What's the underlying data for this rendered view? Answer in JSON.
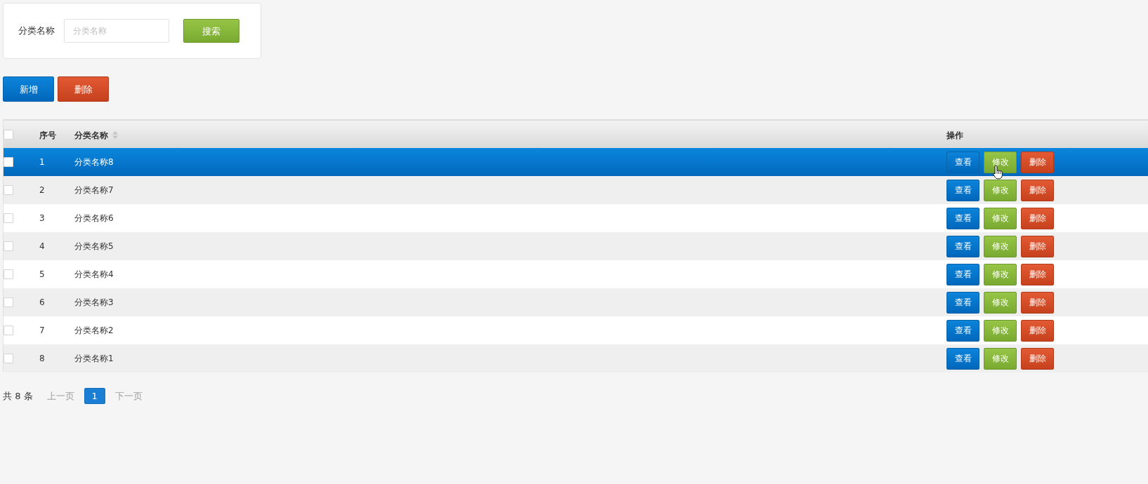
{
  "search": {
    "label": "分类名称",
    "placeholder": "分类名称",
    "button": "搜索"
  },
  "toolbar": [
    {
      "label": "新增",
      "kind": "add"
    },
    {
      "label": "删除",
      "kind": "delete"
    }
  ],
  "table": {
    "select_all": {
      "checked": false
    },
    "columns": [
      {
        "label": "序号",
        "sortable": false
      },
      {
        "label": "分类名称",
        "sortable": true
      },
      {
        "label": "操作",
        "sortable": false
      }
    ],
    "rows": [
      {
        "selected": true,
        "checked": false,
        "number": "1",
        "name": "分类名称8",
        "actions": [
          {
            "label": "查看",
            "kind": "view",
            "hovered": false
          },
          {
            "label": "修改",
            "kind": "edit",
            "hovered": true
          },
          {
            "label": "删除",
            "kind": "delete",
            "hovered": false
          }
        ]
      },
      {
        "selected": false,
        "checked": false,
        "number": "2",
        "name": "分类名称7",
        "actions": [
          {
            "label": "查看",
            "kind": "view",
            "hovered": false
          },
          {
            "label": "修改",
            "kind": "edit",
            "hovered": false
          },
          {
            "label": "删除",
            "kind": "delete",
            "hovered": false
          }
        ]
      },
      {
        "selected": false,
        "checked": false,
        "number": "3",
        "name": "分类名称6",
        "actions": [
          {
            "label": "查看",
            "kind": "view",
            "hovered": false
          },
          {
            "label": "修改",
            "kind": "edit",
            "hovered": false
          },
          {
            "label": "删除",
            "kind": "delete",
            "hovered": false
          }
        ]
      },
      {
        "selected": false,
        "checked": false,
        "number": "4",
        "name": "分类名称5",
        "actions": [
          {
            "label": "查看",
            "kind": "view",
            "hovered": false
          },
          {
            "label": "修改",
            "kind": "edit",
            "hovered": false
          },
          {
            "label": "删除",
            "kind": "delete",
            "hovered": false
          }
        ]
      },
      {
        "selected": false,
        "checked": false,
        "number": "5",
        "name": "分类名称4",
        "actions": [
          {
            "label": "查看",
            "kind": "view",
            "hovered": false
          },
          {
            "label": "修改",
            "kind": "edit",
            "hovered": false
          },
          {
            "label": "删除",
            "kind": "delete",
            "hovered": false
          }
        ]
      },
      {
        "selected": false,
        "checked": false,
        "number": "6",
        "name": "分类名称3",
        "actions": [
          {
            "label": "查看",
            "kind": "view",
            "hovered": false
          },
          {
            "label": "修改",
            "kind": "edit",
            "hovered": false
          },
          {
            "label": "删除",
            "kind": "delete",
            "hovered": false
          }
        ]
      },
      {
        "selected": false,
        "checked": false,
        "number": "7",
        "name": "分类名称2",
        "actions": [
          {
            "label": "查看",
            "kind": "view",
            "hovered": false
          },
          {
            "label": "修改",
            "kind": "edit",
            "hovered": false
          },
          {
            "label": "删除",
            "kind": "delete",
            "hovered": false
          }
        ]
      },
      {
        "selected": false,
        "checked": false,
        "number": "8",
        "name": "分类名称1",
        "actions": [
          {
            "label": "查看",
            "kind": "view",
            "hovered": false
          },
          {
            "label": "修改",
            "kind": "edit",
            "hovered": false
          },
          {
            "label": "删除",
            "kind": "delete",
            "hovered": false
          }
        ]
      }
    ]
  },
  "pagination": {
    "total": "共 8 条",
    "prev": {
      "label": "上一页",
      "disabled": true
    },
    "pages": [
      {
        "label": "1",
        "selected": true
      }
    ],
    "next": {
      "label": "下一页",
      "disabled": true
    }
  }
}
